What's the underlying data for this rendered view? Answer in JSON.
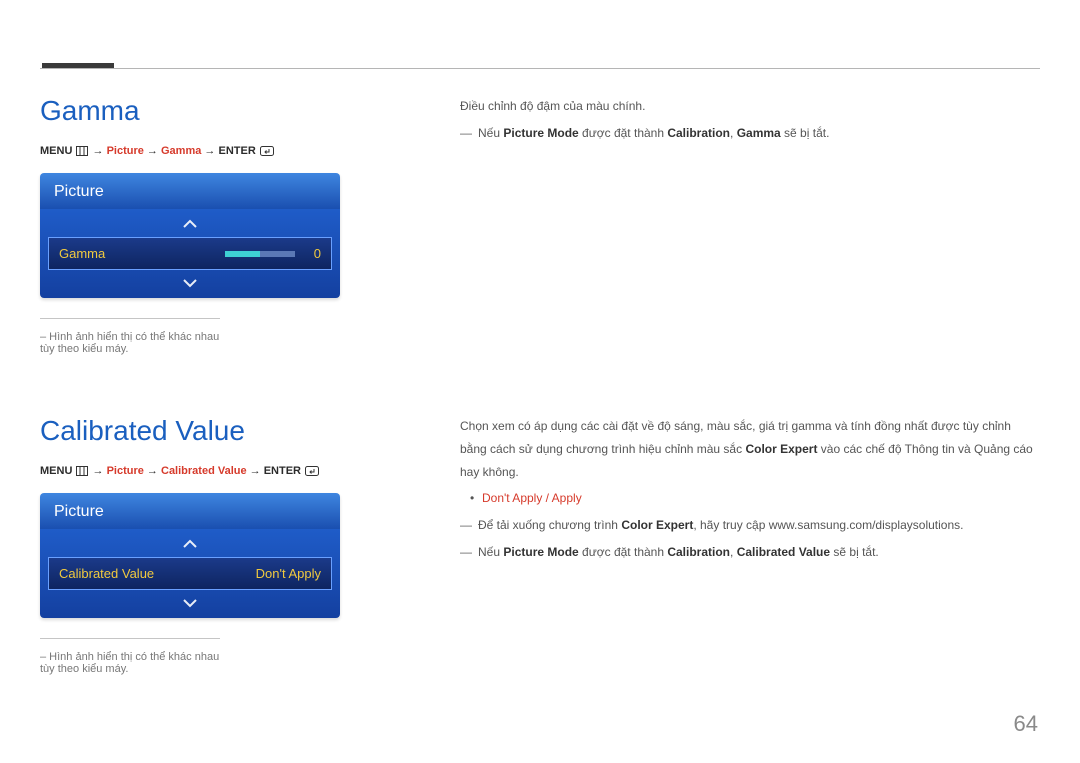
{
  "page_number": "64",
  "gamma": {
    "title": "Gamma",
    "menu_path": {
      "prefix": "MENU ",
      "seg1": "Picture",
      "seg2": "Gamma",
      "suffix": "ENTER"
    },
    "osd": {
      "header": "Picture",
      "row_label": "Gamma",
      "row_value": "0"
    },
    "footnote": "– Hình ảnh hiển thị có thể khác nhau tùy theo kiểu máy.",
    "description": {
      "line1": "Điều chỉnh độ đậm của màu chính.",
      "note_prefix": "Nếu ",
      "note_hl1": "Picture Mode",
      "note_mid": " được đặt thành ",
      "note_b1": "Calibration",
      "note_sep": ", ",
      "note_b2": "Gamma",
      "note_suffix": " sẽ bị tắt."
    }
  },
  "calibrated": {
    "title": "Calibrated Value",
    "menu_path": {
      "prefix": "MENU ",
      "seg1": "Picture",
      "seg2": "Calibrated Value",
      "suffix": "ENTER"
    },
    "osd": {
      "header": "Picture",
      "row_label": "Calibrated Value",
      "row_value": "Don't Apply"
    },
    "footnote": "– Hình ảnh hiển thị có thể khác nhau tùy theo kiểu máy.",
    "description": {
      "line1": "Chọn xem có áp dụng các cài đặt về độ sáng, màu sắc, giá trị gamma và tính đồng nhất được tùy chỉnh bằng cách sử dụng chương trình hiệu chỉnh màu sắc ",
      "line1_b": "Color Expert",
      "line1_suffix": " vào các chế độ Thông tin và Quảng cáo hay không.",
      "options_a": "Don't Apply",
      "options_sep": " / ",
      "options_b": "Apply",
      "note1_prefix": "Để tải xuống chương trình ",
      "note1_b": "Color Expert",
      "note1_suffix": ", hãy truy cập www.samsung.com/displaysolutions.",
      "note2_prefix": "Nếu ",
      "note2_hl1": "Picture Mode",
      "note2_mid": " được đặt thành ",
      "note2_b1": "Calibration",
      "note2_sep": ", ",
      "note2_b2": "Calibrated Value",
      "note2_suffix": " sẽ bị tắt."
    }
  }
}
